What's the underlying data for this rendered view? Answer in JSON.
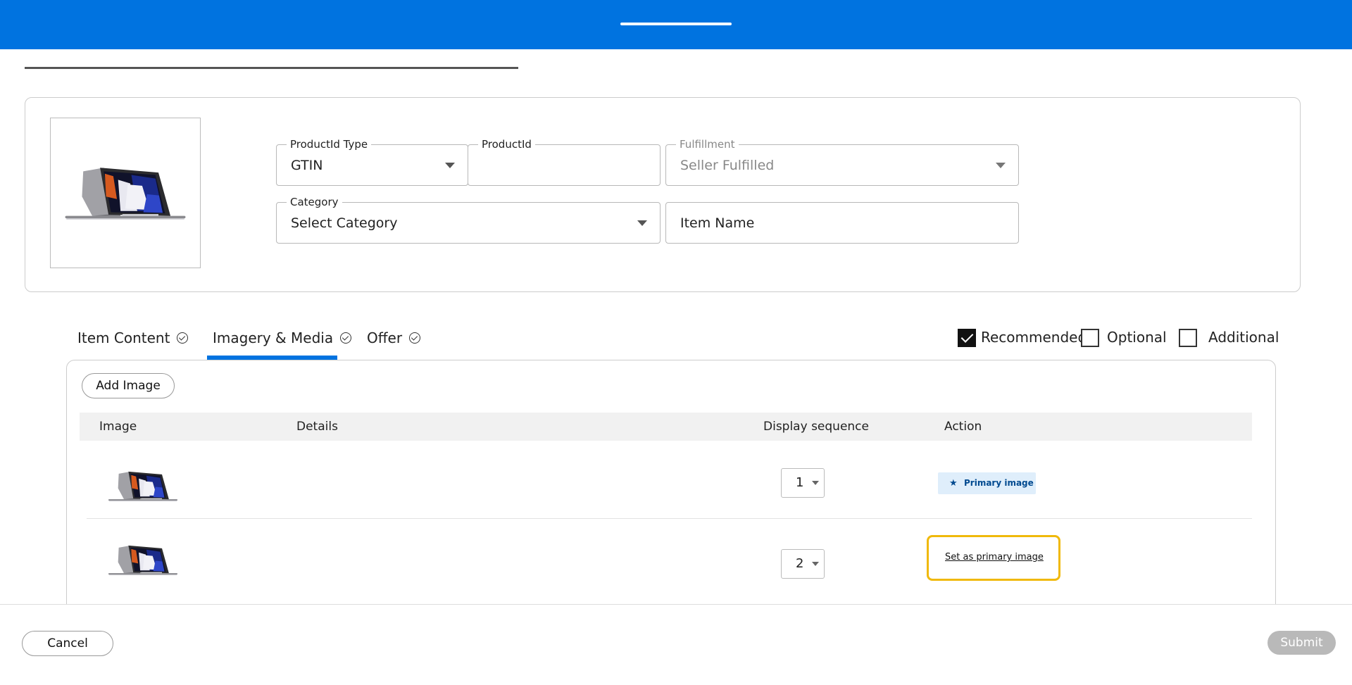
{
  "product": {
    "productid_type": {
      "label": "ProductId Type",
      "value": "GTIN"
    },
    "productid": {
      "label": "ProductId",
      "value": ""
    },
    "fulfillment": {
      "label": "Fulfillment",
      "value": "Seller Fulfilled"
    },
    "category": {
      "label": "Category",
      "value": "Select Category"
    },
    "item_name": {
      "value": "Item Name"
    }
  },
  "tabs": [
    {
      "label": "Item Content",
      "icon": "check-circle-icon"
    },
    {
      "label": "Imagery & Media",
      "icon": "check-circle-icon",
      "active": true
    },
    {
      "label": "Offer",
      "icon": "check-circle-icon"
    }
  ],
  "filters": [
    {
      "label": "Recommended",
      "checked": true
    },
    {
      "label": "Optional",
      "checked": false
    },
    {
      "label": "Additional",
      "checked": false
    }
  ],
  "media": {
    "add_label": "Add Image",
    "columns": [
      "Image",
      "Details",
      "Display sequence",
      "Action"
    ],
    "rows": [
      {
        "sequence": "1",
        "action": "Primary image",
        "action_icon": "star-icon"
      },
      {
        "sequence": "2",
        "action": "Set as primary image"
      }
    ]
  },
  "footer": {
    "cancel": "Cancel",
    "submit": "Submit"
  },
  "colors": {
    "brand_blue": "#0073e0",
    "highlight": "#f0b90b",
    "primary_tag_bg": "#dfeefb"
  }
}
